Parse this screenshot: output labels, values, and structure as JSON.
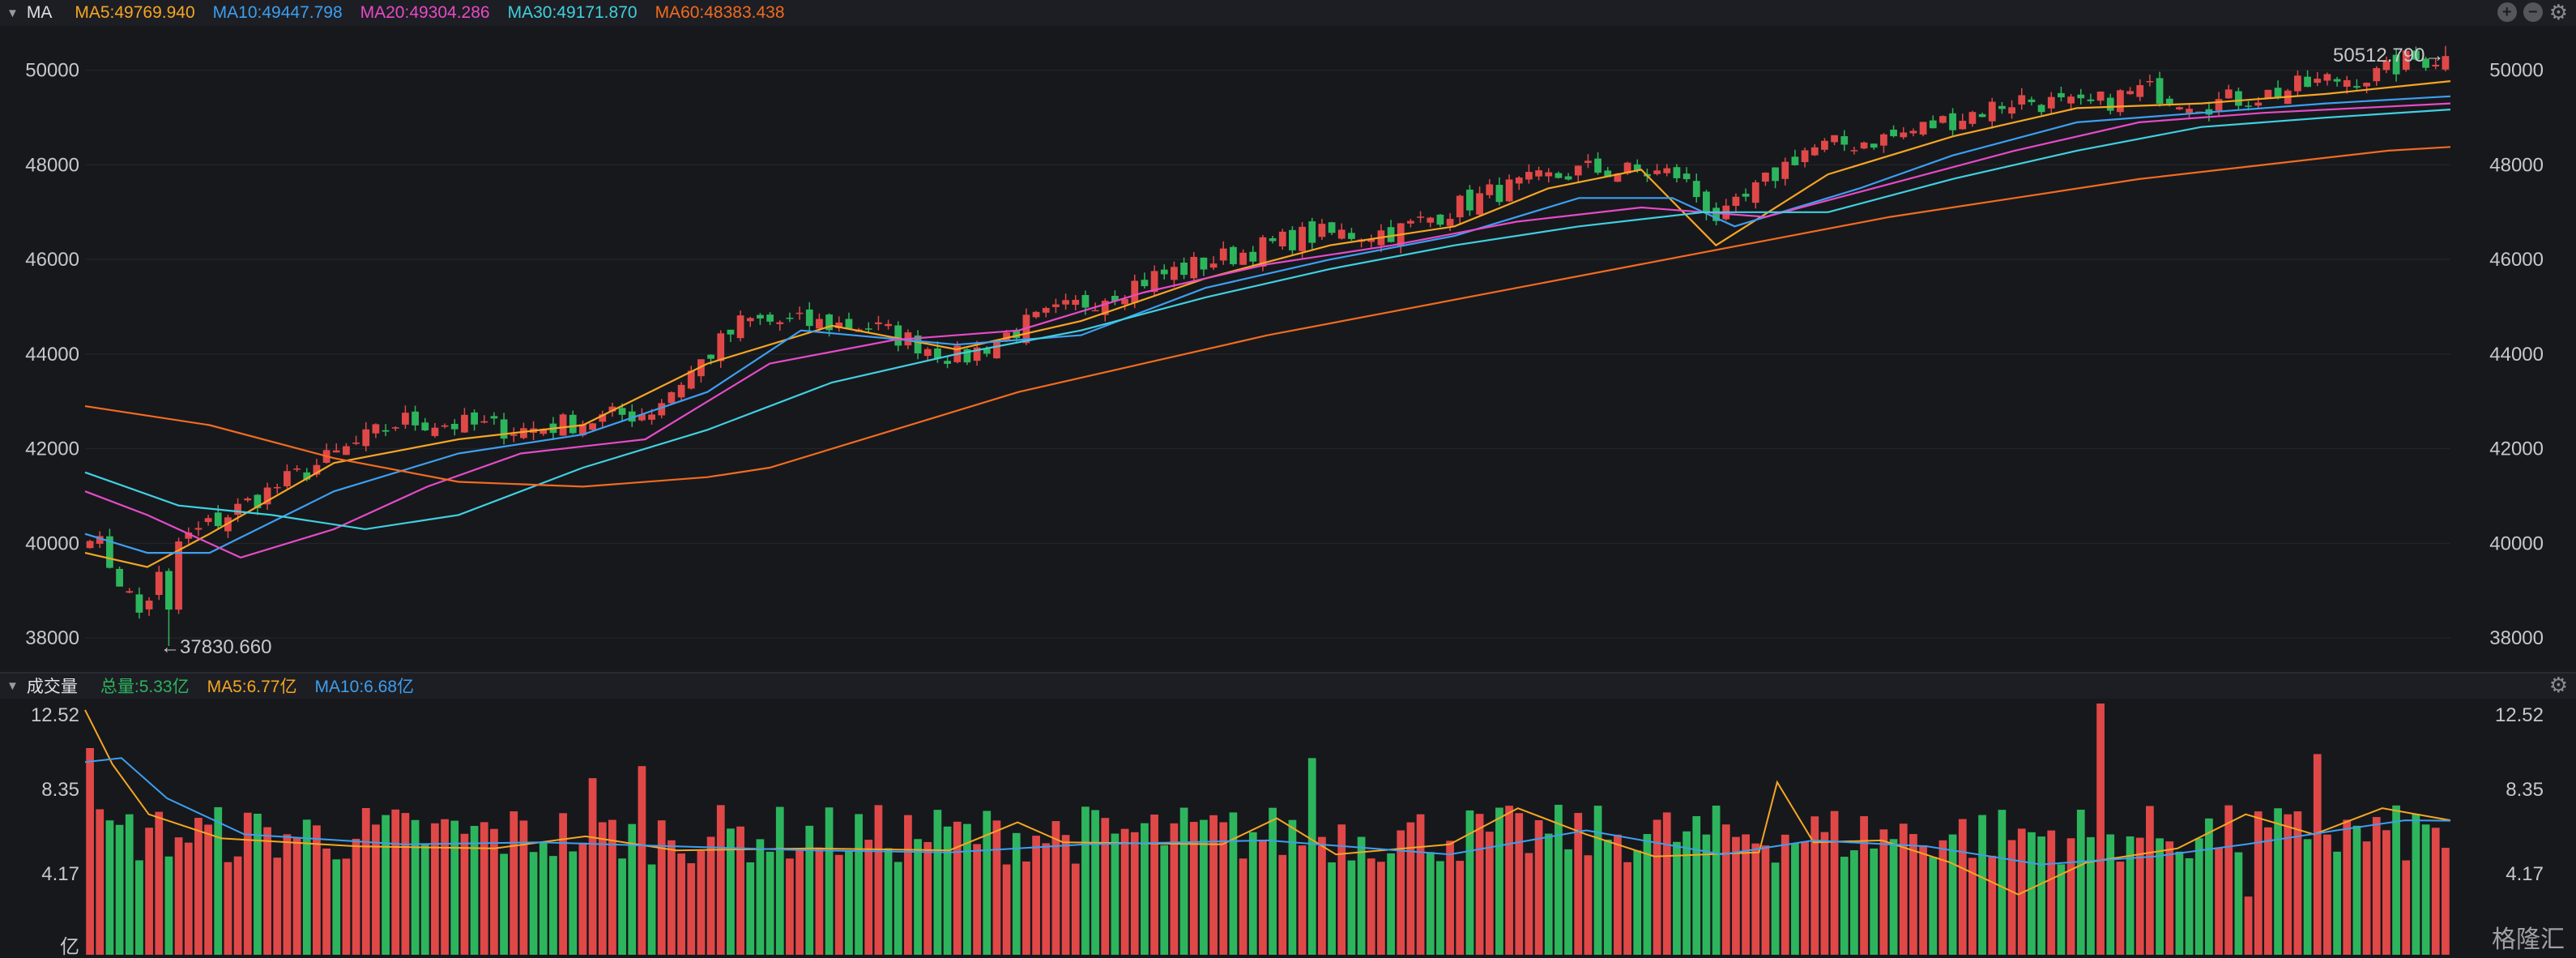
{
  "price_panel": {
    "title": "MA",
    "indicators": [
      {
        "label": "MA5:49769.940",
        "color": "#f5a623"
      },
      {
        "label": "MA10:49447.798",
        "color": "#3c9ff0"
      },
      {
        "label": "MA20:49304.286",
        "color": "#e54bc8"
      },
      {
        "label": "MA30:49171.870",
        "color": "#40d0e0"
      },
      {
        "label": "MA60:48383.438",
        "color": "#f26b21"
      }
    ],
    "y_ticks": [
      "50000",
      "48000",
      "46000",
      "44000",
      "42000",
      "40000",
      "38000"
    ],
    "high_label": "50512.790→",
    "low_label": "←37830.660",
    "controls": [
      "plus-icon",
      "minus-icon",
      "gear-icon"
    ]
  },
  "volume_panel": {
    "title": "成交量",
    "indicators": [
      {
        "label": "总量:5.33亿",
        "color": "#2db55d"
      },
      {
        "label": "MA5:6.77亿",
        "color": "#f5a623"
      },
      {
        "label": "MA10:6.68亿",
        "color": "#3c9ff0"
      }
    ],
    "y_ticks": [
      "12.52",
      "8.35",
      "4.17",
      "亿"
    ]
  },
  "watermark": "格隆汇",
  "colors": {
    "up": "#e04848",
    "down": "#2db55d",
    "background": "#17181c"
  },
  "chart_data": [
    {
      "type": "candlestick",
      "title": "MA",
      "y_range": [
        37300,
        50800
      ],
      "high": 50512.79,
      "low": 37830.66,
      "bar_count": 240,
      "close_path": [
        [
          0,
          40300
        ],
        [
          8,
          38500
        ],
        [
          14,
          40000
        ],
        [
          30,
          41200
        ],
        [
          50,
          42600
        ],
        [
          70,
          42400
        ],
        [
          90,
          42800
        ],
        [
          105,
          44700
        ],
        [
          125,
          44600
        ],
        [
          140,
          43900
        ],
        [
          150,
          44600
        ],
        [
          170,
          45600
        ],
        [
          195,
          46500
        ],
        [
          210,
          46600
        ],
        [
          225,
          47400
        ],
        [
          240,
          47900
        ],
        [
          255,
          47800
        ],
        [
          262,
          46800
        ],
        [
          275,
          48300
        ],
        [
          290,
          48600
        ],
        [
          310,
          49400
        ],
        [
          320,
          49200
        ],
        [
          330,
          49600
        ],
        [
          340,
          49300
        ],
        [
          350,
          49500
        ],
        [
          360,
          49800
        ],
        [
          368,
          49900
        ],
        [
          372,
          50200
        ],
        [
          380,
          50300
        ]
      ],
      "series": [
        {
          "name": "MA5",
          "color": "#f5a623",
          "path": [
            [
              0,
              39800
            ],
            [
              10,
              39500
            ],
            [
              20,
              40200
            ],
            [
              40,
              41700
            ],
            [
              60,
              42200
            ],
            [
              80,
              42500
            ],
            [
              100,
              43800
            ],
            [
              120,
              44600
            ],
            [
              140,
              44100
            ],
            [
              160,
              44700
            ],
            [
              180,
              45600
            ],
            [
              200,
              46300
            ],
            [
              220,
              46700
            ],
            [
              235,
              47500
            ],
            [
              250,
              47900
            ],
            [
              262,
              46300
            ],
            [
              280,
              47800
            ],
            [
              300,
              48600
            ],
            [
              320,
              49200
            ],
            [
              340,
              49300
            ],
            [
              360,
              49500
            ],
            [
              380,
              49770
            ]
          ]
        },
        {
          "name": "MA10",
          "color": "#3c9ff0",
          "path": [
            [
              0,
              40200
            ],
            [
              10,
              39800
            ],
            [
              20,
              39800
            ],
            [
              40,
              41100
            ],
            [
              60,
              41900
            ],
            [
              80,
              42300
            ],
            [
              100,
              43200
            ],
            [
              115,
              44500
            ],
            [
              140,
              44200
            ],
            [
              160,
              44400
            ],
            [
              180,
              45400
            ],
            [
              200,
              46000
            ],
            [
              220,
              46500
            ],
            [
              240,
              47300
            ],
            [
              255,
              47300
            ],
            [
              265,
              46700
            ],
            [
              285,
              47500
            ],
            [
              300,
              48200
            ],
            [
              320,
              48900
            ],
            [
              340,
              49100
            ],
            [
              360,
              49300
            ],
            [
              380,
              49450
            ]
          ]
        },
        {
          "name": "MA20",
          "color": "#e54bc8",
          "path": [
            [
              0,
              41100
            ],
            [
              10,
              40600
            ],
            [
              25,
              39700
            ],
            [
              40,
              40300
            ],
            [
              55,
              41200
            ],
            [
              70,
              41900
            ],
            [
              90,
              42200
            ],
            [
              110,
              43800
            ],
            [
              130,
              44300
            ],
            [
              150,
              44500
            ],
            [
              170,
              45300
            ],
            [
              190,
              45900
            ],
            [
              210,
              46300
            ],
            [
              230,
              46800
            ],
            [
              250,
              47100
            ],
            [
              270,
              46900
            ],
            [
              290,
              47600
            ],
            [
              310,
              48300
            ],
            [
              330,
              48900
            ],
            [
              350,
              49100
            ],
            [
              380,
              49300
            ]
          ]
        },
        {
          "name": "MA30",
          "color": "#40d0e0",
          "path": [
            [
              0,
              41500
            ],
            [
              15,
              40800
            ],
            [
              30,
              40600
            ],
            [
              45,
              40300
            ],
            [
              60,
              40600
            ],
            [
              80,
              41600
            ],
            [
              100,
              42400
            ],
            [
              120,
              43400
            ],
            [
              140,
              44000
            ],
            [
              160,
              44500
            ],
            [
              180,
              45200
            ],
            [
              200,
              45800
            ],
            [
              220,
              46300
            ],
            [
              240,
              46700
            ],
            [
              260,
              47000
            ],
            [
              280,
              47000
            ],
            [
              300,
              47700
            ],
            [
              320,
              48300
            ],
            [
              340,
              48800
            ],
            [
              360,
              49000
            ],
            [
              380,
              49170
            ]
          ]
        },
        {
          "name": "MA60",
          "color": "#f26b21",
          "path": [
            [
              0,
              42900
            ],
            [
              20,
              42500
            ],
            [
              40,
              41800
            ],
            [
              60,
              41300
            ],
            [
              80,
              41200
            ],
            [
              100,
              41400
            ],
            [
              110,
              41600
            ],
            [
              130,
              42400
            ],
            [
              150,
              43200
            ],
            [
              170,
              43800
            ],
            [
              190,
              44400
            ],
            [
              210,
              44900
            ],
            [
              230,
              45400
            ],
            [
              250,
              45900
            ],
            [
              270,
              46400
            ],
            [
              290,
              46900
            ],
            [
              310,
              47300
            ],
            [
              330,
              47700
            ],
            [
              350,
              48000
            ],
            [
              370,
              48300
            ],
            [
              380,
              48380
            ]
          ]
        }
      ]
    },
    {
      "type": "bar",
      "title": "成交量",
      "ylabel": "亿",
      "y_range": [
        0,
        12.52
      ],
      "bar_count": 240,
      "total": 5.33,
      "series": [
        {
          "name": "MA5",
          "color": "#f5a623",
          "path": [
            [
              0,
              12.2
            ],
            [
              6,
              9.5
            ],
            [
              14,
              7.0
            ],
            [
              30,
              5.8
            ],
            [
              60,
              5.4
            ],
            [
              90,
              5.3
            ],
            [
              110,
              5.9
            ],
            [
              130,
              5.2
            ],
            [
              160,
              5.3
            ],
            [
              190,
              5.2
            ],
            [
              205,
              6.6
            ],
            [
              215,
              5.6
            ],
            [
              250,
              5.5
            ],
            [
              262,
              6.8
            ],
            [
              275,
              5.0
            ],
            [
              300,
              5.5
            ],
            [
              315,
              7.3
            ],
            [
              330,
              6.0
            ],
            [
              345,
              4.9
            ],
            [
              368,
              5.1
            ],
            [
              372,
              8.6
            ],
            [
              380,
              5.6
            ],
            [
              395,
              5.7
            ],
            [
              410,
              4.6
            ],
            [
              425,
              3.0
            ],
            [
              440,
              4.6
            ],
            [
              460,
              5.3
            ],
            [
              475,
              7.0
            ],
            [
              490,
              6.0
            ],
            [
              505,
              7.3
            ],
            [
              520,
              6.7
            ]
          ]
        },
        {
          "name": "MA10",
          "color": "#3c9ff0",
          "path": [
            [
              0,
              9.6
            ],
            [
              8,
              9.8
            ],
            [
              18,
              7.8
            ],
            [
              35,
              6.0
            ],
            [
              70,
              5.5
            ],
            [
              100,
              5.6
            ],
            [
              130,
              5.4
            ],
            [
              160,
              5.2
            ],
            [
              190,
              5.1
            ],
            [
              220,
              5.5
            ],
            [
              260,
              5.7
            ],
            [
              300,
              5.0
            ],
            [
              330,
              6.2
            ],
            [
              360,
              5.0
            ],
            [
              380,
              5.7
            ],
            [
              405,
              5.4
            ],
            [
              430,
              4.5
            ],
            [
              455,
              4.9
            ],
            [
              475,
              5.5
            ],
            [
              495,
              6.2
            ],
            [
              510,
              6.7
            ],
            [
              520,
              6.68
            ]
          ]
        }
      ]
    }
  ]
}
